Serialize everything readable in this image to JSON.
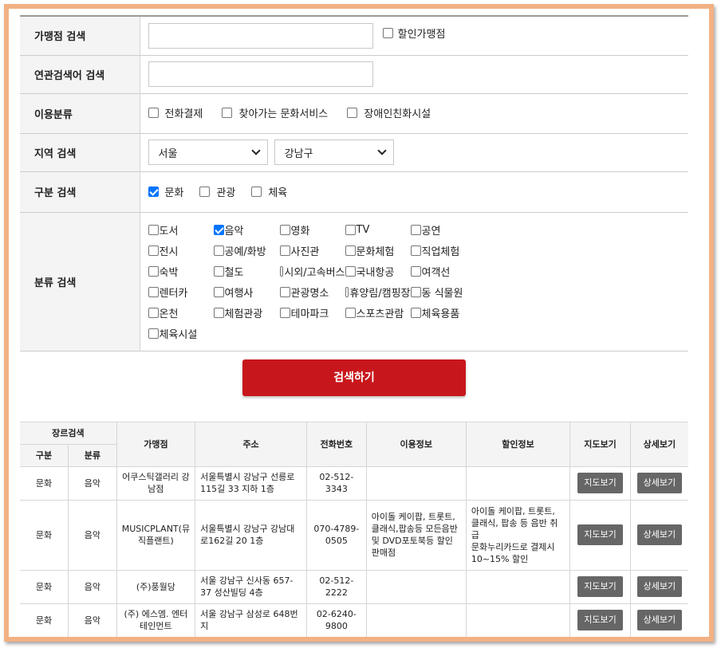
{
  "form": {
    "store_label": "가맹점 검색",
    "store_value": "",
    "discount_label": "할인가맹점",
    "related_label": "연관검색어 검색",
    "related_value": "",
    "usage_label": "이용분류",
    "usage_options": [
      "전화결제",
      "찾아가는 문화서비스",
      "장애인친화시설"
    ],
    "region_label": "지역 검색",
    "region_city": "서울",
    "region_district": "강남구",
    "type_label": "구분 검색",
    "type_options": [
      {
        "label": "문화",
        "checked": true
      },
      {
        "label": "관광",
        "checked": false
      },
      {
        "label": "체육",
        "checked": false
      }
    ],
    "category_label": "분류 검색",
    "categories": [
      {
        "label": "도서",
        "checked": false
      },
      {
        "label": "음악",
        "checked": true
      },
      {
        "label": "영화",
        "checked": false
      },
      {
        "label": "TV",
        "checked": false
      },
      {
        "label": "공연",
        "checked": false
      },
      {
        "label": "전시",
        "checked": false
      },
      {
        "label": "공예/화방",
        "checked": false
      },
      {
        "label": "사진관",
        "checked": false
      },
      {
        "label": "문화체험",
        "checked": false
      },
      {
        "label": "직업체험",
        "checked": false
      },
      {
        "label": "숙박",
        "checked": false
      },
      {
        "label": "철도",
        "checked": false
      },
      {
        "label": "시외/고속버스",
        "checked": false
      },
      {
        "label": "국내항공",
        "checked": false
      },
      {
        "label": "여객선",
        "checked": false
      },
      {
        "label": "렌터카",
        "checked": false
      },
      {
        "label": "여행사",
        "checked": false
      },
      {
        "label": "관광명소",
        "checked": false
      },
      {
        "label": "휴양림/캠핑장",
        "checked": false
      },
      {
        "label": "동 식물원",
        "checked": false
      },
      {
        "label": "온천",
        "checked": false
      },
      {
        "label": "체험관광",
        "checked": false
      },
      {
        "label": "테마파크",
        "checked": false
      },
      {
        "label": "스포츠관람",
        "checked": false
      },
      {
        "label": "체육용품",
        "checked": false
      },
      {
        "label": "체육시설",
        "checked": false
      }
    ],
    "search_button": "검색하기"
  },
  "results": {
    "headers": {
      "genre": "장르검색",
      "type": "구분",
      "category": "분류",
      "store": "가맹점",
      "address": "주소",
      "phone": "전화번호",
      "usage": "이용정보",
      "discount": "할인정보",
      "map": "지도보기",
      "detail": "상세보기"
    },
    "map_btn": "지도보기",
    "detail_btn": "상세보기",
    "rows": [
      {
        "type": "문화",
        "category": "음악",
        "store": "어쿠스틱갤러리 강남점",
        "address": "서울특별시 강남구 선릉로115길 33 지하 1층",
        "phone": "02-512-3343",
        "usage": "",
        "discount": ""
      },
      {
        "type": "문화",
        "category": "음악",
        "store": "MUSICPLANT(뮤직플랜트)",
        "address": "서울특별시 강남구 강남대로162길 20 1층",
        "phone": "070-4789-0505",
        "usage": "아이돌 케이팝, 트롯트, 클래식,팝송등 모든음반 및 DVD포토북등 할인 판매점",
        "discount": "아이돌 케이팝, 트롯트, 클래식, 팝송 등 음반 취급\n문화누리카드로 결제시 10~15% 할인"
      },
      {
        "type": "문화",
        "category": "음악",
        "store": "(주)풍월당",
        "address": "서울 강남구 신사동 657-37 성산빌딩 4층",
        "phone": "02-512-2222",
        "usage": "",
        "discount": ""
      },
      {
        "type": "문화",
        "category": "음악",
        "store": "(주) 에스엠. 엔터테인먼트",
        "address": "서울 강남구 삼성로 648번지",
        "phone": "02-6240-9800",
        "usage": "",
        "discount": ""
      }
    ]
  },
  "colors": {
    "frame_border": "#f3b183",
    "search_button": "#c8171c",
    "action_button": "#666666",
    "checkbox_on": "#0075ff"
  }
}
